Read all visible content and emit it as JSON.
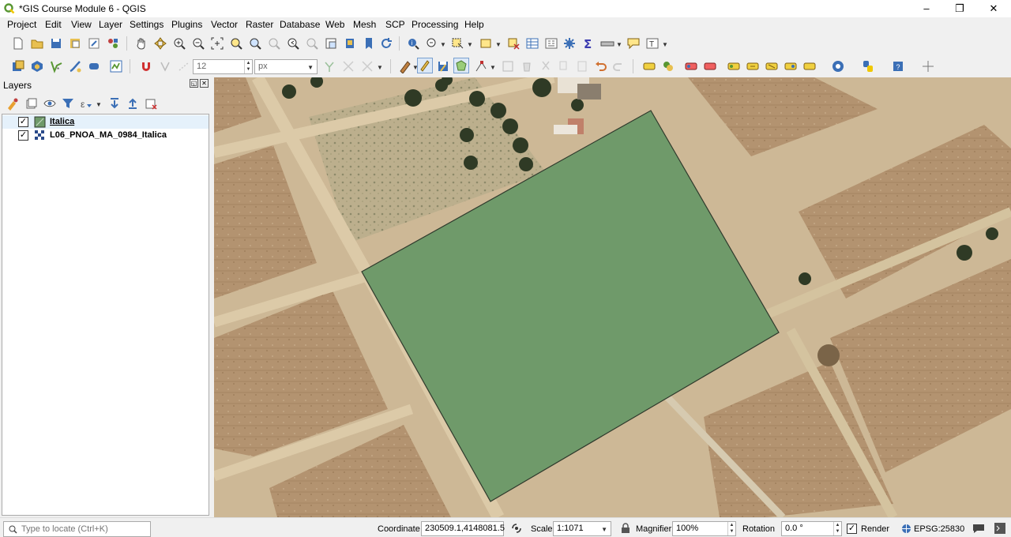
{
  "window": {
    "title": "*GIS Course Module 6 - QGIS",
    "minimize_glyph": "–",
    "restore_glyph": "❐",
    "close_glyph": "✕"
  },
  "menu": [
    "Project",
    "Edit",
    "View",
    "Layer",
    "Settings",
    "Plugins",
    "Vector",
    "Raster",
    "Database",
    "Web",
    "Mesh",
    "SCP",
    "Processing",
    "Help"
  ],
  "digitizing": {
    "snap_tolerance": "12",
    "snap_units": "px"
  },
  "layers_panel": {
    "title": "Layers",
    "layers": [
      {
        "name": "Italica",
        "checked": true,
        "type": "polygon",
        "icon": "polygon-layer-icon"
      },
      {
        "name": "L06_PNOA_MA_0984_Italica",
        "checked": true,
        "type": "raster",
        "icon": "raster-layer-icon"
      }
    ]
  },
  "map": {
    "polygon_fill": "#6f9a6a",
    "polygon_stroke": "#2f3a2c"
  },
  "status": {
    "locate_placeholder": "Type to locate (Ctrl+K)",
    "coordinate_label": "Coordinate",
    "coordinate_value": "230509.1,4148081.5",
    "scale_label": "Scale",
    "scale_value": "1:1071",
    "magnifier_label": "Magnifier",
    "magnifier_value": "100%",
    "rotation_label": "Rotation",
    "rotation_value": "0.0 °",
    "render_label": "Render",
    "render_checked": true,
    "crs": "EPSG:25830"
  },
  "colors": {
    "qgis_green": "#589632",
    "qgis_yellow": "#f0c800"
  }
}
